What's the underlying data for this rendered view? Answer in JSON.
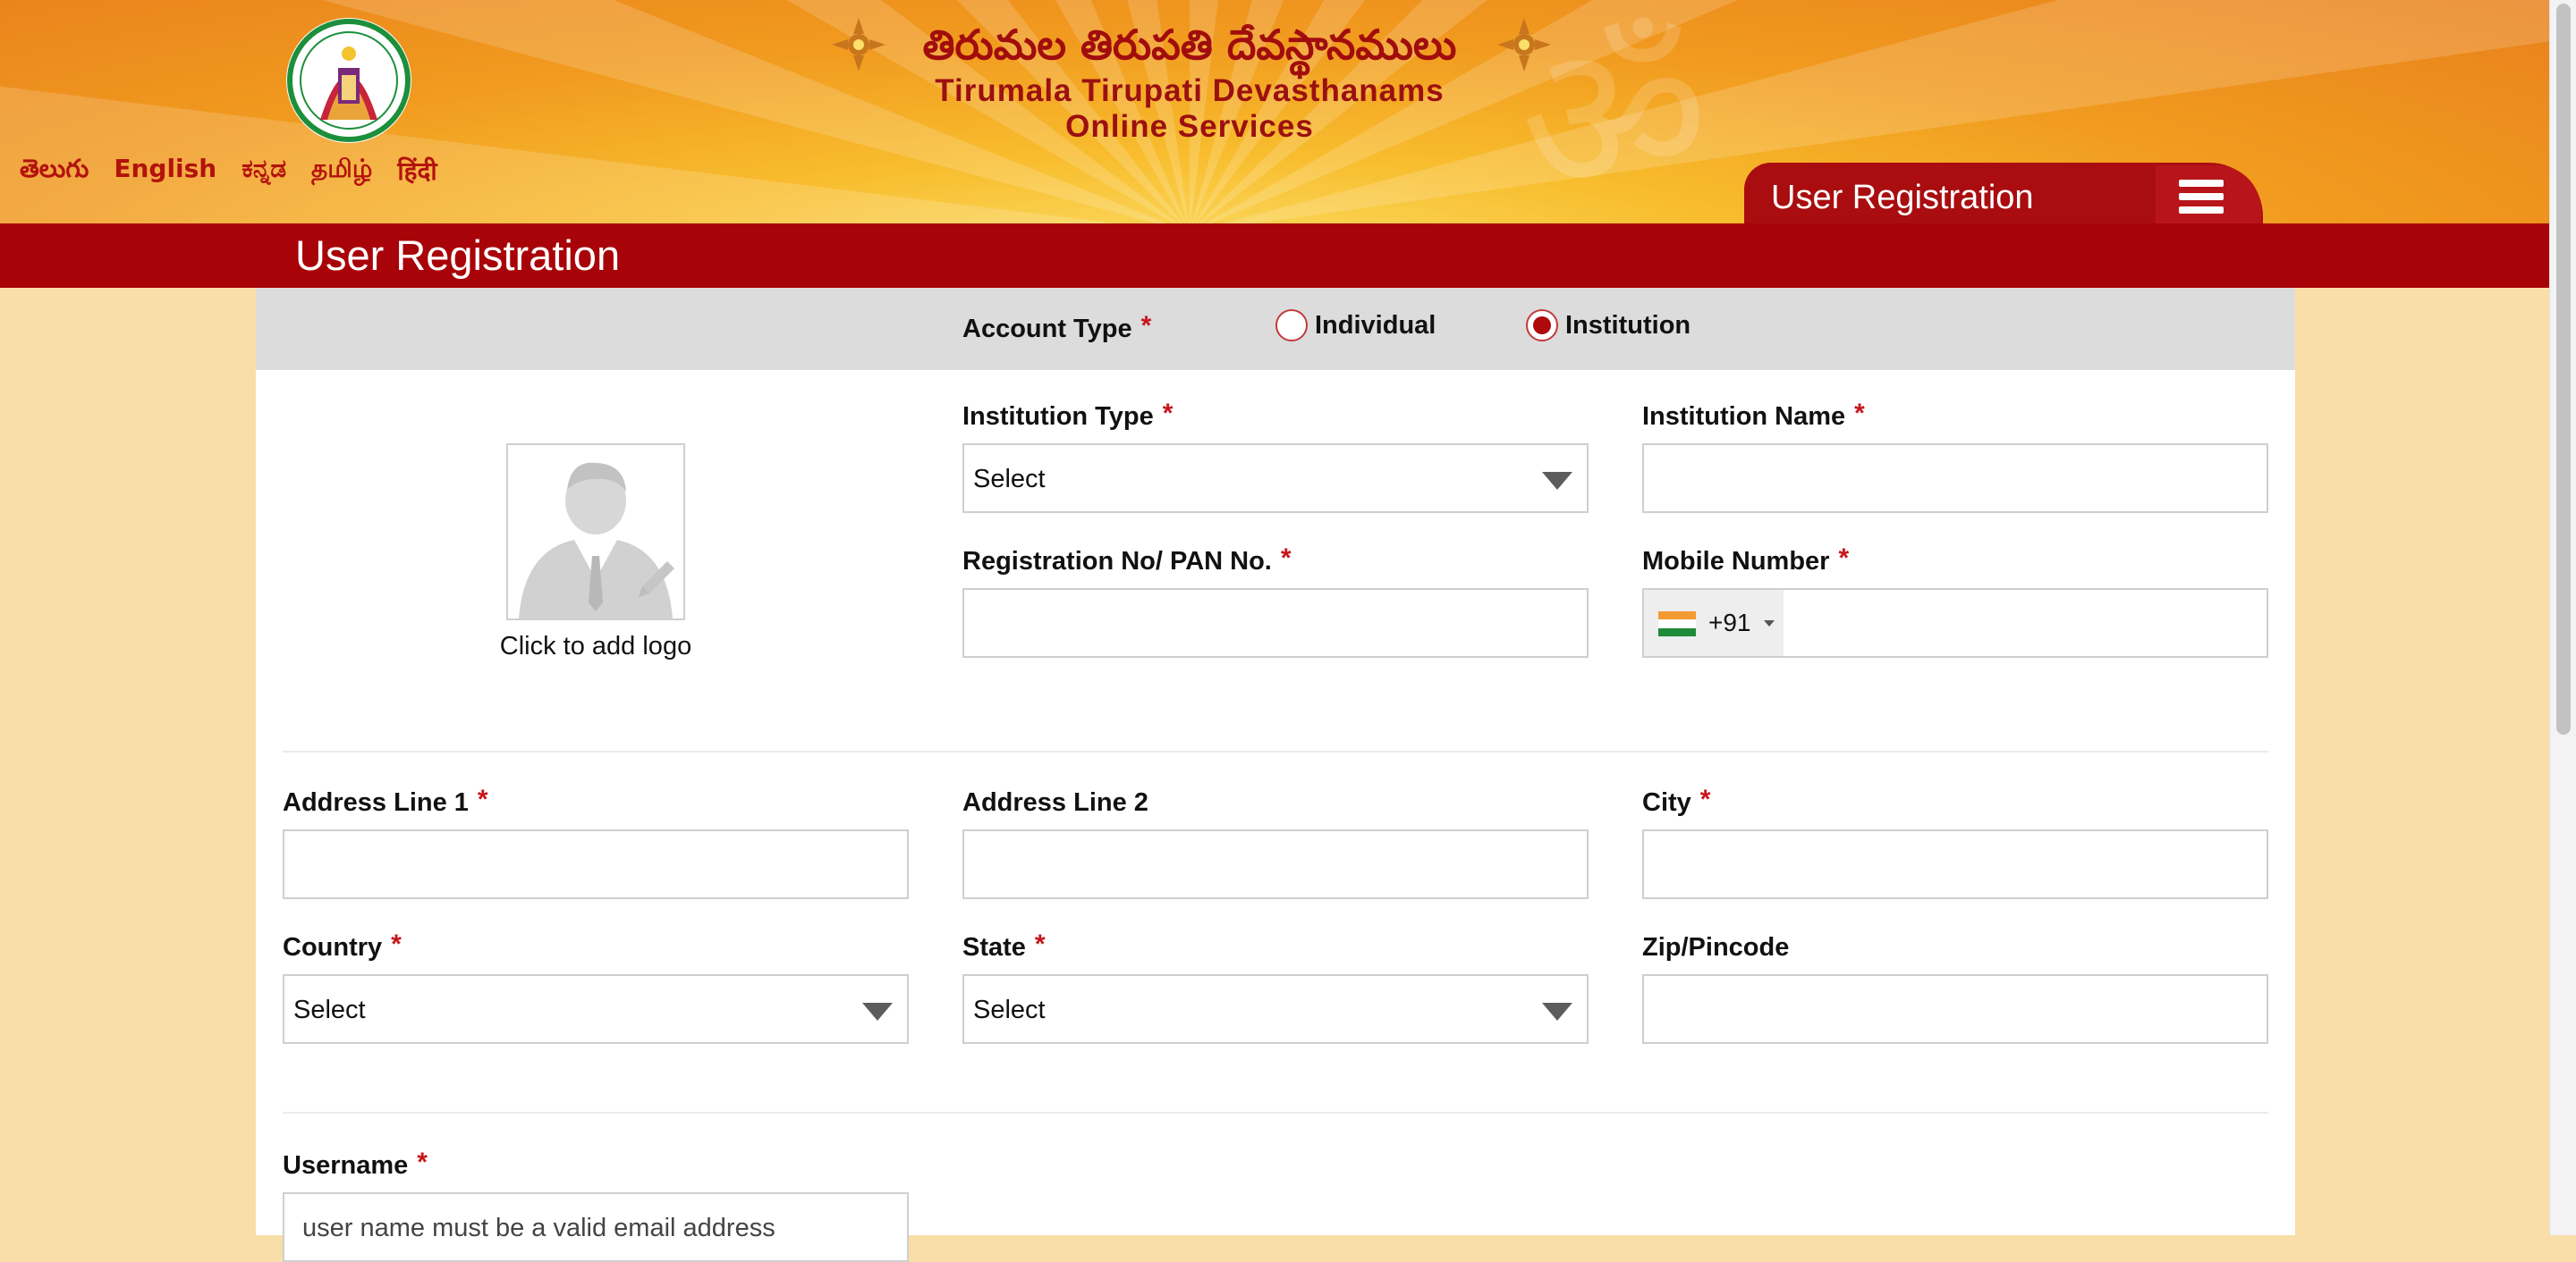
{
  "header": {
    "telugu_title": "తిరుమల తిరుపతి దేవస్థానములు",
    "title_line1": "Tirumala Tirupati Devasthanams",
    "title_line2": "Online Services",
    "languages": [
      "తెలుగు",
      "English",
      "ಕನ್ನಡ",
      "தமிழ்",
      "हिंदी"
    ],
    "tab_label": "User Registration",
    "brand_color": "#a80309"
  },
  "page": {
    "title": "User Registration"
  },
  "form": {
    "account_type": {
      "label": "Account Type",
      "required": "*",
      "options": [
        "Individual",
        "Institution"
      ],
      "selected": "Institution"
    },
    "logo_caption": "Click to add logo",
    "institution_type": {
      "label": "Institution Type",
      "required": "*",
      "value": "Select"
    },
    "institution_name": {
      "label": "Institution Name",
      "required": "*",
      "value": ""
    },
    "registration_no": {
      "label": "Registration No/ PAN No.",
      "required": "*",
      "value": ""
    },
    "mobile_number": {
      "label": "Mobile Number",
      "required": "*",
      "country_code": "+91",
      "value": ""
    },
    "address_line1": {
      "label": "Address Line 1",
      "required": "*",
      "value": ""
    },
    "address_line2": {
      "label": "Address Line 2",
      "value": ""
    },
    "city": {
      "label": "City",
      "required": "*",
      "value": ""
    },
    "country": {
      "label": "Country",
      "required": "*",
      "value": "Select"
    },
    "state": {
      "label": "State",
      "required": "*",
      "value": "Select"
    },
    "zip": {
      "label": "Zip/Pincode",
      "value": ""
    },
    "username": {
      "label": "Username",
      "required": "*",
      "placeholder": "user name must be a valid email address"
    }
  }
}
